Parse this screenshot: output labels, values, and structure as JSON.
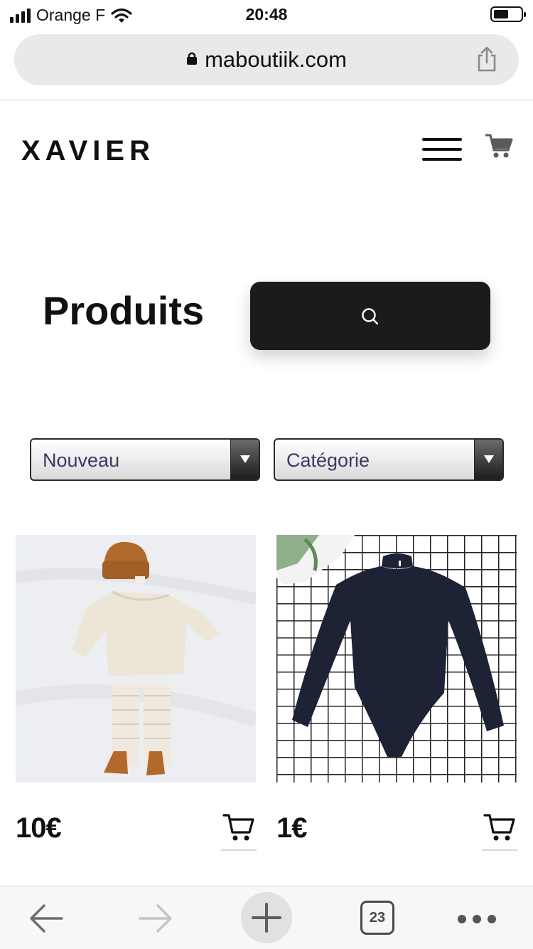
{
  "status_bar": {
    "carrier": "Orange F",
    "time": "20:48"
  },
  "browser": {
    "url": "maboutiik.com",
    "tab_count": "23"
  },
  "site": {
    "brand": "XAVIER",
    "page_title": "Produits"
  },
  "filters": {
    "sort_value": "Nouveau",
    "category_value": "Catégorie"
  },
  "products": [
    {
      "price": "10€"
    },
    {
      "price": "1€"
    }
  ],
  "colors": {
    "accent_dark": "#1b1b1b",
    "select_text": "#3a3a66",
    "url_bar_bg": "#e9e9ec"
  },
  "icons": {
    "lock": "lock-icon",
    "share": "share-icon",
    "menu": "hamburger-menu-icon",
    "cart": "shopping-cart-icon",
    "search": "search-icon",
    "back": "back-arrow-icon",
    "forward": "forward-arrow-icon",
    "new_tab": "plus-icon",
    "more": "more-dots-icon"
  }
}
